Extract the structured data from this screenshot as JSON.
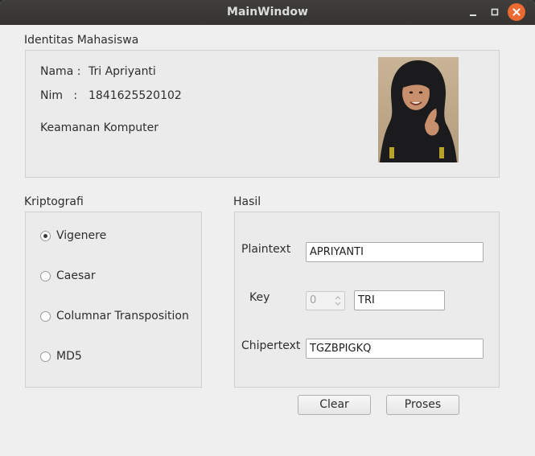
{
  "window": {
    "title": "MainWindow",
    "minimize_icon": "minimize-icon",
    "maximize_icon": "maximize-icon",
    "close_icon": "close-icon"
  },
  "identity": {
    "heading": "Identitas Mahasiswa",
    "name_label": "Nama :",
    "name_value": "Tri Apriyanti",
    "nim_label": "Nim   :",
    "nim_value": "1841625520102",
    "major": "Keamanan Komputer"
  },
  "crypto": {
    "heading": "Kriptografi",
    "options": [
      {
        "label": "Vigenere",
        "selected": true
      },
      {
        "label": "Caesar",
        "selected": false
      },
      {
        "label": "Columnar Transposition",
        "selected": false
      },
      {
        "label": "MD5",
        "selected": false
      }
    ]
  },
  "result": {
    "heading": "Hasil",
    "plaintext_label": "Plaintext",
    "plaintext_value": "APRIYANTI",
    "key_label": "Key",
    "key_number": "0",
    "key_value": "TRI",
    "chipertext_label": "Chipertext",
    "chipertext_value": "TGZBPIGKQ"
  },
  "buttons": {
    "clear": "Clear",
    "proses": "Proses"
  },
  "colors": {
    "titlebar": "#383734",
    "close_button": "#ea6a31",
    "window_bg": "#efefef"
  }
}
